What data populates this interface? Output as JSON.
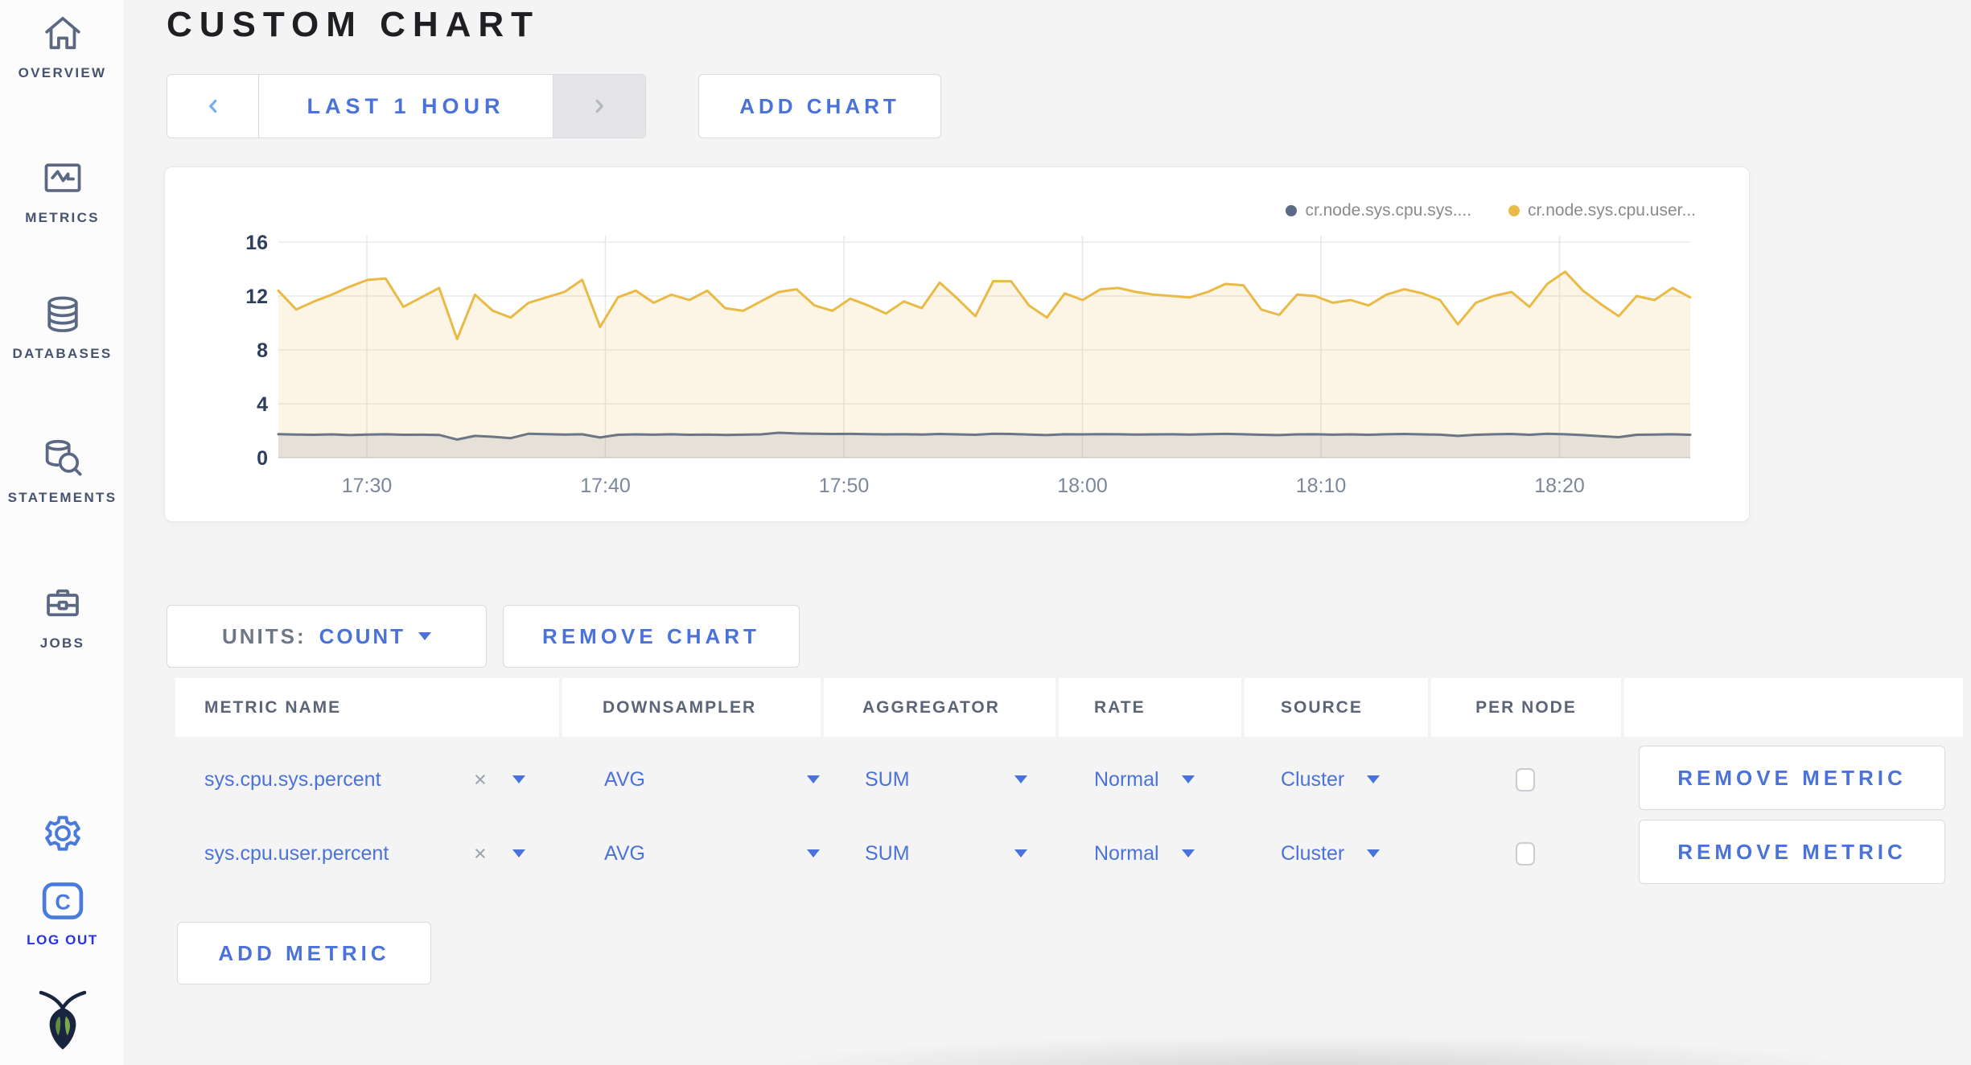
{
  "sidebar": {
    "items": [
      {
        "label": "OVERVIEW"
      },
      {
        "label": "METRICS"
      },
      {
        "label": "DATABASES"
      },
      {
        "label": "STATEMENTS"
      },
      {
        "label": "JOBS"
      }
    ],
    "logout_label": "LOG OUT"
  },
  "header": {
    "title": "CUSTOM CHART",
    "time_range_label": "LAST 1 HOUR",
    "add_chart_label": "ADD CHART"
  },
  "chart_card": {
    "legend": [
      {
        "label": "cr.node.sys.cpu.sys....",
        "color": "#5c6a87"
      },
      {
        "label": "cr.node.sys.cpu.user...",
        "color": "#e9ba45"
      }
    ]
  },
  "chart_data": {
    "type": "line",
    "title": "",
    "xlabel": "",
    "ylabel": "",
    "x_ticks": [
      "17:30",
      "17:40",
      "17:50",
      "18:00",
      "18:10",
      "18:20"
    ],
    "y_ticks": [
      16,
      12,
      8,
      4,
      0
    ],
    "ylim": [
      0,
      16
    ],
    "grid": true,
    "legend_position": "top-right",
    "series": [
      {
        "name": "cr.node.sys.cpu.sys....",
        "color": "#6b7586",
        "fill": "rgba(107,117,134,0.15)",
        "values": [
          1.75,
          1.72,
          1.7,
          1.73,
          1.68,
          1.72,
          1.74,
          1.7,
          1.71,
          1.69,
          1.35,
          1.62,
          1.55,
          1.45,
          1.78,
          1.75,
          1.72,
          1.74,
          1.5,
          1.7,
          1.73,
          1.71,
          1.74,
          1.7,
          1.72,
          1.69,
          1.71,
          1.73,
          1.85,
          1.8,
          1.78,
          1.76,
          1.77,
          1.75,
          1.73,
          1.74,
          1.72,
          1.76,
          1.73,
          1.7,
          1.78,
          1.76,
          1.72,
          1.68,
          1.74,
          1.73,
          1.75,
          1.74,
          1.72,
          1.73,
          1.74,
          1.72,
          1.75,
          1.77,
          1.74,
          1.7,
          1.68,
          1.73,
          1.74,
          1.71,
          1.73,
          1.7,
          1.74,
          1.76,
          1.73,
          1.71,
          1.62,
          1.7,
          1.74,
          1.76,
          1.7,
          1.78,
          1.74,
          1.68,
          1.6,
          1.52,
          1.7,
          1.72,
          1.74,
          1.7
        ]
      },
      {
        "name": "cr.node.sys.cpu.user...",
        "color": "#e9ba45",
        "fill": "rgba(233,186,69,0.14)",
        "values": [
          12.4,
          11.0,
          11.6,
          12.1,
          12.7,
          13.2,
          13.3,
          11.2,
          11.9,
          12.6,
          8.8,
          12.1,
          10.9,
          10.4,
          11.5,
          11.9,
          12.3,
          13.2,
          9.7,
          11.9,
          12.4,
          11.5,
          12.1,
          11.7,
          12.4,
          11.1,
          10.9,
          11.6,
          12.3,
          12.5,
          11.3,
          10.9,
          11.8,
          11.3,
          10.7,
          11.6,
          11.1,
          13.0,
          11.8,
          10.5,
          13.1,
          13.1,
          11.3,
          10.4,
          12.2,
          11.7,
          12.5,
          12.6,
          12.3,
          12.1,
          12.0,
          11.9,
          12.3,
          12.9,
          12.8,
          11.0,
          10.6,
          12.1,
          12.0,
          11.5,
          11.7,
          11.3,
          12.1,
          12.5,
          12.2,
          11.7,
          9.9,
          11.5,
          12.0,
          12.3,
          11.2,
          12.9,
          13.8,
          12.4,
          11.4,
          10.5,
          12.0,
          11.7,
          12.6,
          11.9
        ]
      }
    ]
  },
  "chart_controls": {
    "units_label": "UNITS:",
    "units_value": "COUNT",
    "remove_chart_label": "REMOVE CHART",
    "add_metric_label": "ADD METRIC"
  },
  "metrics_table": {
    "headers": {
      "metric_name": "METRIC NAME",
      "downsampler": "DOWNSAMPLER",
      "aggregator": "AGGREGATOR",
      "rate": "RATE",
      "source": "SOURCE",
      "per_node": "PER NODE"
    },
    "rows": [
      {
        "metric_name": "sys.cpu.sys.percent",
        "clear": "×",
        "downsampler": "AVG",
        "aggregator": "SUM",
        "rate": "Normal",
        "source": "Cluster",
        "per_node_checked": false,
        "remove_label": "REMOVE METRIC"
      },
      {
        "metric_name": "sys.cpu.user.percent",
        "clear": "×",
        "downsampler": "AVG",
        "aggregator": "SUM",
        "rate": "Normal",
        "source": "Cluster",
        "per_node_checked": false,
        "remove_label": "REMOVE METRIC"
      }
    ]
  }
}
